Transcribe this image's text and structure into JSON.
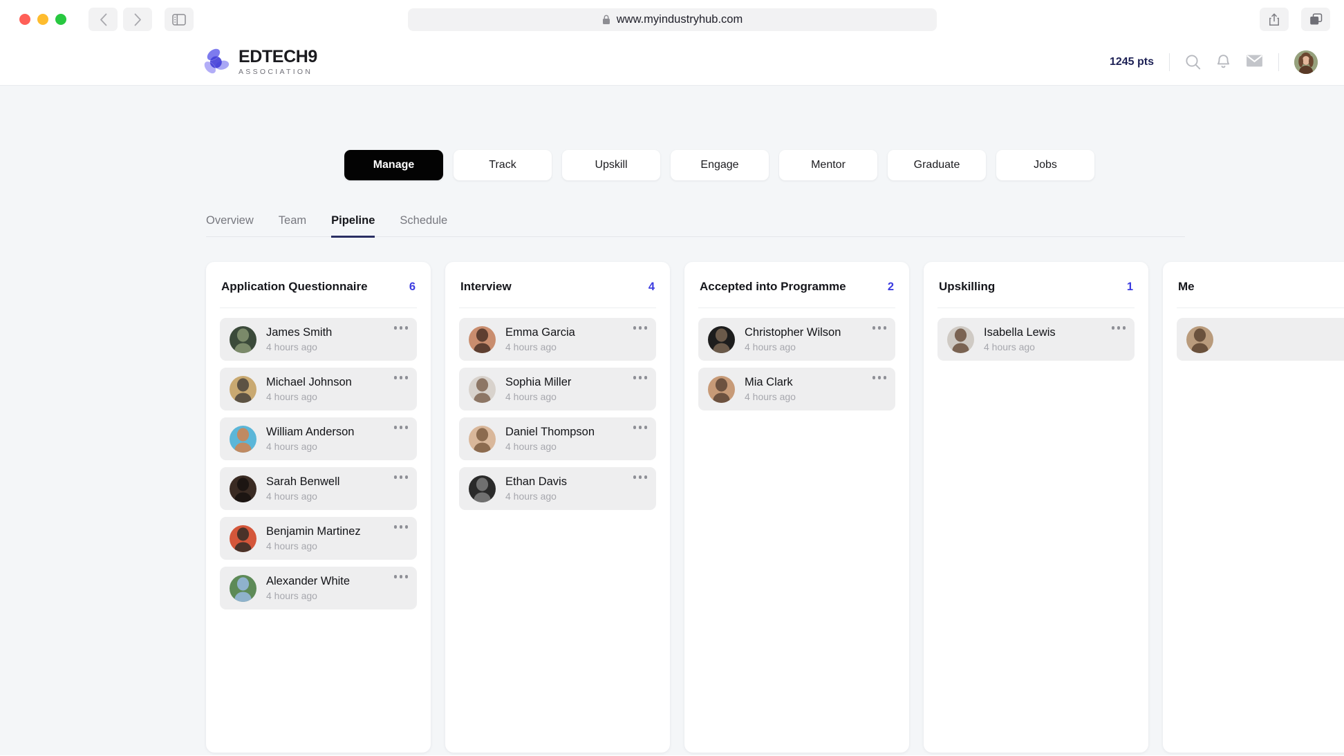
{
  "browser": {
    "url": "www.myindustryhub.com",
    "lock_icon": "lock-icon",
    "back_icon": "chevron-left-icon",
    "forward_icon": "chevron-right-icon",
    "sidebar_icon": "sidebar-toggle-icon",
    "share_icon": "share-icon",
    "tabs_icon": "tabs-overview-icon"
  },
  "header": {
    "logo_title": "EDTECH9",
    "logo_subtitle": "ASSOCIATION",
    "points": "1245 pts",
    "search_icon": "search-icon",
    "bell_icon": "bell-icon",
    "mail_icon": "mail-icon",
    "avatar": "user-avatar"
  },
  "mainnav": {
    "items": [
      {
        "label": "Manage",
        "active": true
      },
      {
        "label": "Track",
        "active": false
      },
      {
        "label": "Upskill",
        "active": false
      },
      {
        "label": "Engage",
        "active": false
      },
      {
        "label": "Mentor",
        "active": false
      },
      {
        "label": "Graduate",
        "active": false
      },
      {
        "label": "Jobs",
        "active": false
      }
    ]
  },
  "subtabs": {
    "items": [
      {
        "label": "Overview",
        "active": false
      },
      {
        "label": "Team",
        "active": false
      },
      {
        "label": "Pipeline",
        "active": true
      },
      {
        "label": "Schedule",
        "active": false
      }
    ]
  },
  "colors": {
    "accent_count": "#3c3ce0",
    "active_pill_bg": "#030303",
    "active_tab_underline": "#2a2f63",
    "points_text": "#1d2155",
    "page_bg": "#f4f6f8",
    "card_bg": "#eeeeef"
  },
  "board": {
    "columns": [
      {
        "title": "Application Questionnaire",
        "count": "6",
        "cards": [
          {
            "name": "James Smith",
            "time": "4 hours ago",
            "av1": "#3b4a3a",
            "av2": "#7b8a6a"
          },
          {
            "name": "Michael Johnson",
            "time": "4 hours ago",
            "av1": "#c9a971",
            "av2": "#5d5344"
          },
          {
            "name": "William Anderson",
            "time": "4 hours ago",
            "av1": "#5bb6d8",
            "av2": "#c08a62"
          },
          {
            "name": "Sarah Benwell",
            "time": "4 hours ago",
            "av1": "#3a2b23",
            "av2": "#1c1512"
          },
          {
            "name": "Benjamin Martinez",
            "time": "4 hours ago",
            "av1": "#d4563a",
            "av2": "#4a3229"
          },
          {
            "name": "Alexander White",
            "time": "4 hours ago",
            "av1": "#5d8a57",
            "av2": "#8fb2cc"
          }
        ]
      },
      {
        "title": "Interview",
        "count": "4",
        "cards": [
          {
            "name": "Emma Garcia",
            "time": "4 hours ago",
            "av1": "#c98d6e",
            "av2": "#5e3f31"
          },
          {
            "name": "Sophia Miller",
            "time": "4 hours ago",
            "av1": "#d8d2cc",
            "av2": "#8d7665"
          },
          {
            "name": "Daniel Thompson",
            "time": "4 hours ago",
            "av1": "#d9b79a",
            "av2": "#8c6b4f"
          },
          {
            "name": "Ethan Davis",
            "time": "4 hours ago",
            "av1": "#2a2a2a",
            "av2": "#707070"
          }
        ]
      },
      {
        "title": "Accepted into Programme",
        "count": "2",
        "cards": [
          {
            "name": "Christopher Wilson",
            "time": "4 hours ago",
            "av1": "#1d1d1d",
            "av2": "#6b5a4a"
          },
          {
            "name": "Mia Clark",
            "time": "4 hours ago",
            "av1": "#c79a77",
            "av2": "#6d5240"
          }
        ]
      },
      {
        "title": "Upskilling",
        "count": "1",
        "cards": [
          {
            "name": "Isabella Lewis",
            "time": "4 hours ago",
            "av1": "#cfcac4",
            "av2": "#7a6352"
          }
        ]
      },
      {
        "title": "Me",
        "count": "",
        "truncated": true,
        "cards": [
          {
            "name": "",
            "time": "",
            "av1": "#b99b7c",
            "av2": "#6a513c"
          }
        ]
      }
    ]
  }
}
